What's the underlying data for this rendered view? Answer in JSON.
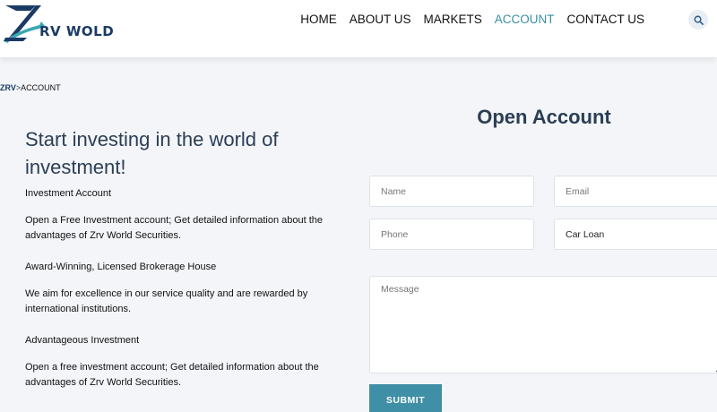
{
  "header": {
    "logo_text": "RV WOLD",
    "nav": [
      {
        "label": "HOME",
        "active": false
      },
      {
        "label": "ABOUT US",
        "active": false
      },
      {
        "label": "MARKETS",
        "active": false
      },
      {
        "label": "ACCOUNT",
        "active": true
      },
      {
        "label": "CONTACT US",
        "active": false
      }
    ],
    "search_icon": "search-icon"
  },
  "breadcrumb": {
    "root": "ZRV",
    "separator": ">",
    "current": "ACCOUNT"
  },
  "left": {
    "headline": "Start investing in the world of investment!",
    "features": [
      {
        "title": "Investment Account",
        "desc": "Open a Free Investment account; Get detailed information about the advantages of Zrv World Securities."
      },
      {
        "title": "Award-Winning, Licensed Brokerage House",
        "desc": "We aim for excellence in our service quality and are rewarded by international institutions."
      },
      {
        "title": "Advantageous Investment",
        "desc": "Open a free investment account; Get detailed information about the advantages of Zrv World  Securities."
      }
    ]
  },
  "form": {
    "title": "Open Account",
    "name_placeholder": "Name",
    "email_placeholder": "Email",
    "phone_placeholder": "Phone",
    "subject_selected": "Car Loan",
    "message_placeholder": "Message",
    "submit_label": "SUBMIT"
  },
  "colors": {
    "brand": "#1b3b66",
    "accent": "#3a8fa5",
    "button": "#3f8fa6",
    "background": "#f3f5f8"
  }
}
